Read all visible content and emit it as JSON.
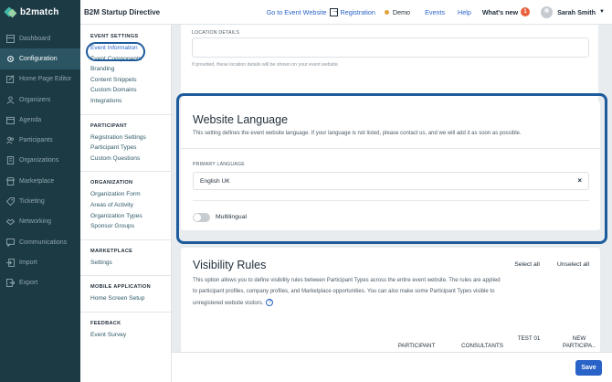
{
  "topbar": {
    "brand": "b2match",
    "event_name": "B2M Startup Directive",
    "goto_event": "Go to Event Website",
    "registration": "Registration",
    "demo": "Demo",
    "events": "Events",
    "help": "Help",
    "whats_new": "What's new",
    "whats_new_count": "1",
    "user_name": "Sarah Smith"
  },
  "sidebar": {
    "items": [
      {
        "label": "Dashboard",
        "icon": "dashboard-icon"
      },
      {
        "label": "Configuration",
        "icon": "gear-icon"
      },
      {
        "label": "Home Page Editor",
        "icon": "edit-icon"
      },
      {
        "label": "Organizers",
        "icon": "users-icon"
      },
      {
        "label": "Agenda",
        "icon": "calendar-icon"
      },
      {
        "label": "Participants",
        "icon": "participants-icon"
      },
      {
        "label": "Organizations",
        "icon": "building-icon"
      },
      {
        "label": "Marketplace",
        "icon": "marketplace-icon"
      },
      {
        "label": "Ticketing",
        "icon": "ticket-icon"
      },
      {
        "label": "Networking",
        "icon": "networking-icon"
      },
      {
        "label": "Communications",
        "icon": "chat-icon"
      },
      {
        "label": "Import",
        "icon": "import-icon"
      },
      {
        "label": "Export",
        "icon": "export-icon"
      }
    ]
  },
  "menu": {
    "event_settings": {
      "title": "EVENT SETTINGS",
      "items": [
        "Event Information",
        "Event Components",
        "Branding",
        "Content Snippets",
        "Custom Domains",
        "Integrations"
      ]
    },
    "participant": {
      "title": "PARTICIPANT",
      "items": [
        "Registration Settings",
        "Participant Types",
        "Custom Questions"
      ]
    },
    "organization": {
      "title": "ORGANIZATION",
      "items": [
        "Organization Form",
        "Areas of Activity",
        "Organization Types",
        "Sponsor Groups"
      ]
    },
    "marketplace": {
      "title": "MARKETPLACE",
      "items": [
        "Settings"
      ]
    },
    "mobile": {
      "title": "MOBILE APPLICATION",
      "items": [
        "Home Screen Setup"
      ]
    },
    "feedback": {
      "title": "FEEDBACK",
      "items": [
        "Event Survey"
      ]
    }
  },
  "location": {
    "label": "LOCATION DETAILS",
    "hint": "If provided, these location details will be shown on your event website."
  },
  "website_language": {
    "title": "Website Language",
    "description": "This setting defines the event website language. If your language is not listed, please contact us, and we will add it as soon as possible.",
    "primary_label": "PRIMARY LANGUAGE",
    "primary_value": "English UK",
    "clear_symbol": "×",
    "multilingual_label": "Multilingual",
    "multilingual_enabled": false
  },
  "visibility_rules": {
    "title": "Visibility Rules",
    "select_all": "Select all",
    "unselect_all": "Unselect all",
    "description": "This option allows you to define visibility rules between Participant Types across the entire event website. The rules are applied to participant profiles, company profiles, and Marketplace opportunities. You can also make some Participant Types visible to unregistered website visitors.",
    "help_symbol": "?",
    "columns": [
      "PARTICIPANT",
      "CONSULTANTS",
      "TEST 01",
      "NEW PARTICIPA..."
    ]
  },
  "footer": {
    "save_label": "Save"
  },
  "colors": {
    "sidebar_bg": "#1c3a44",
    "accent": "#2a63c8",
    "highlight": "#1d5b9c"
  }
}
